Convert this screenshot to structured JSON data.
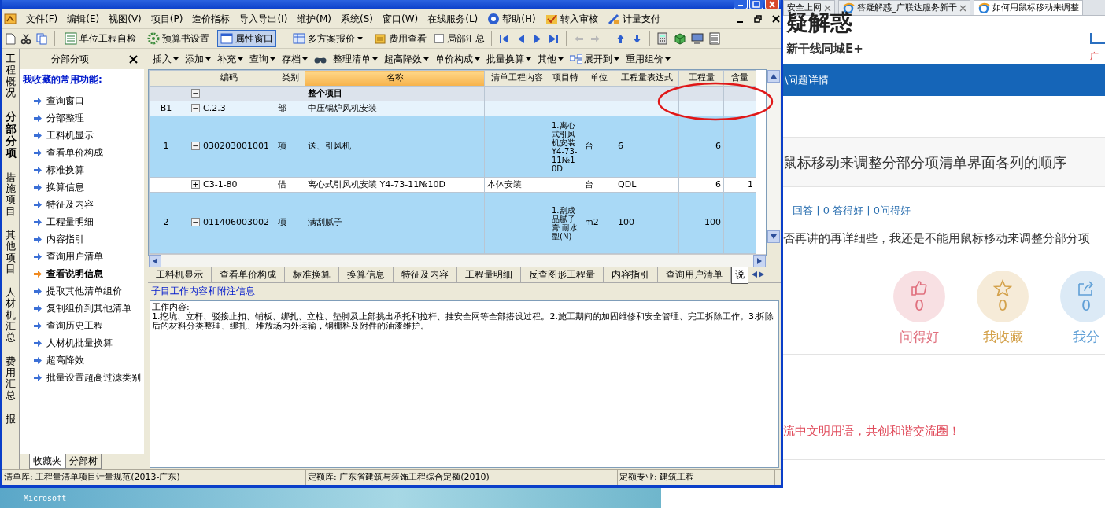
{
  "browser": {
    "tabs": [
      {
        "label": "安全上网",
        "selected": false
      },
      {
        "label": "答疑解惑_广联达服务新干",
        "selected": false
      },
      {
        "label": "如何用鼠标移动来调整",
        "selected": true
      }
    ],
    "site_title": "疑解惑",
    "site_subtitle": "新干线同城E+",
    "corner_text": "广",
    "breadcrumb": "\\问题详情",
    "question_title": "鼠标移动来调整分部分项清单界面各列的顺序",
    "stats": "回答 | 0 答得好 | 0问得好",
    "question_body": "否再讲的再详细些，我还是不能用鼠标移动来调整分部分项",
    "actions": [
      {
        "kind": "like",
        "count": "0",
        "label": "问得好",
        "color": "#e0707e"
      },
      {
        "kind": "star",
        "count": "0",
        "label": "我收藏",
        "color": "#d4a24c"
      },
      {
        "kind": "share",
        "count": "0",
        "label": "我分",
        "color": "#5f9fd6"
      }
    ],
    "notice": "流中文明用语，共创和谐交流圈！"
  },
  "app": {
    "menu": [
      {
        "kind": "plain",
        "label": "文件(F)"
      },
      {
        "kind": "plain",
        "label": "编辑(E)"
      },
      {
        "kind": "plain",
        "label": "视图(V)"
      },
      {
        "kind": "plain",
        "label": "项目(P)"
      },
      {
        "kind": "plain",
        "label": "造价指标"
      },
      {
        "kind": "plain",
        "label": "导入导出(I)"
      },
      {
        "kind": "plain",
        "label": "维护(M)"
      },
      {
        "kind": "plain",
        "label": "系统(S)"
      },
      {
        "kind": "plain",
        "label": "窗口(W)"
      },
      {
        "kind": "plain",
        "label": "在线服务(L)"
      },
      {
        "kind": "help",
        "label": "帮助(H)"
      },
      {
        "kind": "audit",
        "label": "转入审核"
      },
      {
        "kind": "payment",
        "label": "计量支付"
      }
    ],
    "toolbar": [
      {
        "kind": "button",
        "label": "单位工程自检",
        "selected": false
      },
      {
        "kind": "button",
        "label": "预算书设置",
        "selected": false
      },
      {
        "kind": "button",
        "label": "属性窗口",
        "selected": true
      },
      {
        "kind": "dropdown",
        "label": "多方案报价",
        "selected": false
      },
      {
        "kind": "button",
        "label": "费用查看",
        "selected": false
      },
      {
        "kind": "checkbox",
        "label": "局部汇总",
        "checked": false
      }
    ],
    "side_tabs": [
      {
        "label": "工程概况",
        "selected": false
      },
      {
        "label": "分部分项",
        "selected": true
      },
      {
        "label": "措施项目",
        "selected": false
      },
      {
        "label": "其他项目",
        "selected": false
      },
      {
        "label": "人材机汇总",
        "selected": false
      },
      {
        "label": "费用汇总",
        "selected": false
      },
      {
        "label": "报",
        "selected": false
      }
    ],
    "panel": {
      "title": "分部分项",
      "heading": "我收藏的常用功能:",
      "items": [
        {
          "label": "查询窗口",
          "selected": false
        },
        {
          "label": "分部整理",
          "selected": false
        },
        {
          "label": "工料机显示",
          "selected": false
        },
        {
          "label": "查看单价构成",
          "selected": false
        },
        {
          "label": "标准换算",
          "selected": false
        },
        {
          "label": "换算信息",
          "selected": false
        },
        {
          "label": "特征及内容",
          "selected": false
        },
        {
          "label": "工程量明细",
          "selected": false
        },
        {
          "label": "内容指引",
          "selected": false
        },
        {
          "label": "查询用户清单",
          "selected": false
        },
        {
          "label": "查看说明信息",
          "selected": true
        },
        {
          "label": "提取其他清单组价",
          "selected": false
        },
        {
          "label": "复制组价到其他清单",
          "selected": false
        },
        {
          "label": "查询历史工程",
          "selected": false
        },
        {
          "label": "人材机批量换算",
          "selected": false
        },
        {
          "label": "超高降效",
          "selected": false
        },
        {
          "label": "批量设置超高过滤类别",
          "selected": false
        }
      ],
      "bottom_tabs": [
        {
          "label": "收藏夹",
          "selected": true
        },
        {
          "label": "分部树",
          "selected": false
        }
      ]
    },
    "toolbar2": [
      "插入",
      "添加",
      "补充",
      "查询",
      "存档",
      "整理清单",
      "超高降效",
      "单价构成",
      "批量换算",
      "其他",
      "展开到",
      "重用组价"
    ],
    "grid": {
      "columns": [
        {
          "label": "编码",
          "selected": false
        },
        {
          "label": "类别",
          "selected": false
        },
        {
          "label": "名称",
          "selected": true
        },
        {
          "label": "清单工程内容",
          "selected": false
        },
        {
          "label": "项目特",
          "selected": false
        },
        {
          "label": "单位",
          "selected": false
        },
        {
          "label": "工程量表达式",
          "selected": false
        },
        {
          "label": "工程量",
          "selected": false
        },
        {
          "label": "含量",
          "selected": false
        }
      ],
      "rows": [
        {
          "kind": "project",
          "toggle": "−",
          "name": "整个项目"
        },
        {
          "kind": "division",
          "number": "B1",
          "toggle": "−",
          "code": "C.2.3",
          "type": "部",
          "name": "中压锅炉风机安装"
        },
        {
          "kind": "item",
          "number": "1",
          "toggle": "−",
          "code": "030203001001",
          "type": "项",
          "name": "送、引风机",
          "feature": "1.离心式引风机安装 Y4-73-11№10D",
          "unit": "台",
          "expression": "6",
          "quantity": "6"
        },
        {
          "kind": "quota",
          "toggle": "+",
          "code": "C3-1-80",
          "type": "借",
          "name": "离心式引风机安装 Y4-73-11№10D",
          "content": "本体安装",
          "unit": "台",
          "expression": "QDL",
          "quantity": "6",
          "ratio": "1"
        },
        {
          "kind": "item",
          "number": "2",
          "toggle": "−",
          "code": "011406003002",
          "type": "项",
          "name": "满刮腻子",
          "feature": "1.刮成品腻子膏 耐水型(N)",
          "unit": "m2",
          "expression": "100",
          "quantity": "100"
        }
      ]
    },
    "detail_tabs": [
      {
        "label": "工料机显示",
        "selected": false
      },
      {
        "label": "查看单价构成",
        "selected": false
      },
      {
        "label": "标准换算",
        "selected": false
      },
      {
        "label": "换算信息",
        "selected": false
      },
      {
        "label": "特征及内容",
        "selected": false
      },
      {
        "label": "工程量明细",
        "selected": false
      },
      {
        "label": "反查图形工程量",
        "selected": false
      },
      {
        "label": "内容指引",
        "selected": false
      },
      {
        "label": "查询用户清单",
        "selected": false
      },
      {
        "label": "说",
        "selected": true
      }
    ],
    "notes": {
      "heading": "子目工作内容和附注信息",
      "lines": [
        "工作内容:",
        "1.挖坑、立杆、驳接止扣、铺板、绑扎、立柱、垫脚及上部挑出承托和拉杆、挂安全网等全部搭设过程。2.施工期间的加固维修和安全管理、完工拆除工作。3.拆除后的材料分类整理、绑扎、堆放场内外运输，钢棚料及附件的油漆维护。"
      ]
    },
    "status": [
      "清单库: 工程量清单项目计量规范(2013-广东)",
      "定额库: 广东省建筑与装饰工程综合定额(2010)",
      "定额专业: 建筑工程"
    ]
  },
  "desktop": {
    "icon_label": "Microsoft"
  }
}
